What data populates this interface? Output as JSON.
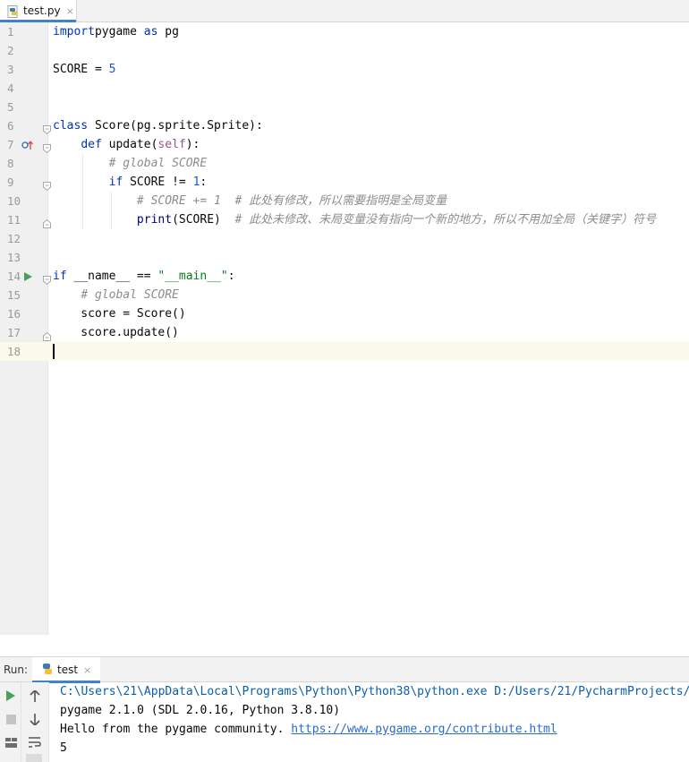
{
  "tab": {
    "title": "test.py",
    "close": "×",
    "icon": "python-file-icon"
  },
  "editor": {
    "lines": [
      {
        "num": "1",
        "tokens": [
          [
            "kw",
            "import"
          ],
          [
            "",
            "pygame "
          ],
          [
            "kw",
            "as"
          ],
          [
            "",
            " pg"
          ]
        ]
      },
      {
        "num": "2",
        "tokens": []
      },
      {
        "num": "3",
        "tokens": [
          [
            "",
            "SCORE = "
          ],
          [
            "num",
            "5"
          ]
        ]
      },
      {
        "num": "4",
        "tokens": []
      },
      {
        "num": "5",
        "tokens": []
      },
      {
        "num": "6",
        "tokens": [
          [
            "kw",
            "class"
          ],
          [
            "",
            " Score(pg.sprite.Sprite):"
          ]
        ]
      },
      {
        "num": "7",
        "tokens": [
          [
            "",
            "    "
          ],
          [
            "kw",
            "def"
          ],
          [
            "",
            " update("
          ],
          [
            "self",
            "self"
          ],
          [
            "",
            "):"
          ]
        ]
      },
      {
        "num": "8",
        "tokens": [
          [
            "",
            "        "
          ],
          [
            "cmt",
            "# global SCORE"
          ]
        ]
      },
      {
        "num": "9",
        "tokens": [
          [
            "",
            "        "
          ],
          [
            "kw",
            "if"
          ],
          [
            "",
            " SCORE != "
          ],
          [
            "num",
            "1"
          ],
          [
            "",
            ":"
          ]
        ]
      },
      {
        "num": "10",
        "tokens": [
          [
            "",
            "            "
          ],
          [
            "cmt",
            "# SCORE += 1  # 此处有修改，所以需要指明是全局变量"
          ]
        ]
      },
      {
        "num": "11",
        "tokens": [
          [
            "",
            "            "
          ],
          [
            "builtin",
            "print"
          ],
          [
            "",
            "(SCORE)  "
          ],
          [
            "cmt",
            "# 此处未修改、未局变量没有指向一个新的地方，所以不用加全局（关键字）符号"
          ]
        ]
      },
      {
        "num": "12",
        "tokens": []
      },
      {
        "num": "13",
        "tokens": []
      },
      {
        "num": "14",
        "tokens": [
          [
            "kw",
            "if"
          ],
          [
            "",
            " __name__ == "
          ],
          [
            "str",
            "\"__main__\""
          ],
          [
            "",
            ":"
          ]
        ]
      },
      {
        "num": "15",
        "tokens": [
          [
            "",
            "    "
          ],
          [
            "cmt",
            "# global SCORE"
          ]
        ]
      },
      {
        "num": "16",
        "tokens": [
          [
            "",
            "    score = Score()"
          ]
        ]
      },
      {
        "num": "17",
        "tokens": [
          [
            "",
            "    score.update()"
          ]
        ]
      },
      {
        "num": "18",
        "tokens": []
      }
    ],
    "current_line": "18"
  },
  "run": {
    "label": "Run:",
    "tab_title": "test",
    "tab_close": "×",
    "console": {
      "path_line": "C:\\Users\\21\\AppData\\Local\\Programs\\Python\\Python38\\python.exe D:/Users/21/PycharmProjects/",
      "line2": "pygame 2.1.0 (SDL 2.0.16, Python 3.8.10)",
      "line3_text": "Hello from the pygame community. ",
      "line3_link": "https://www.pygame.org/contribute.html",
      "line4": "5"
    }
  },
  "colors": {
    "keyword": "#0033b3",
    "number": "#1750eb",
    "string": "#067d17",
    "comment": "#8c8c8c",
    "self": "#94558d",
    "accent": "#4083c9"
  }
}
